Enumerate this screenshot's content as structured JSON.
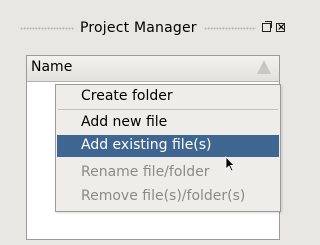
{
  "window": {
    "title": "Project Manager"
  },
  "tree": {
    "column_header": "Name"
  },
  "context_menu": {
    "items": [
      {
        "label": "Create folder",
        "enabled": true
      },
      {
        "label": "Add new file",
        "enabled": true
      },
      {
        "label": "Add existing file(s)",
        "enabled": true,
        "highlighted": true
      },
      {
        "label": "Rename file/folder",
        "enabled": false
      },
      {
        "label": "Remove file(s)/folder(s)",
        "enabled": false
      }
    ]
  },
  "colors": {
    "highlight": "#3f6690",
    "disabled_text": "#8c8a86",
    "background": "#e9e7e3"
  }
}
